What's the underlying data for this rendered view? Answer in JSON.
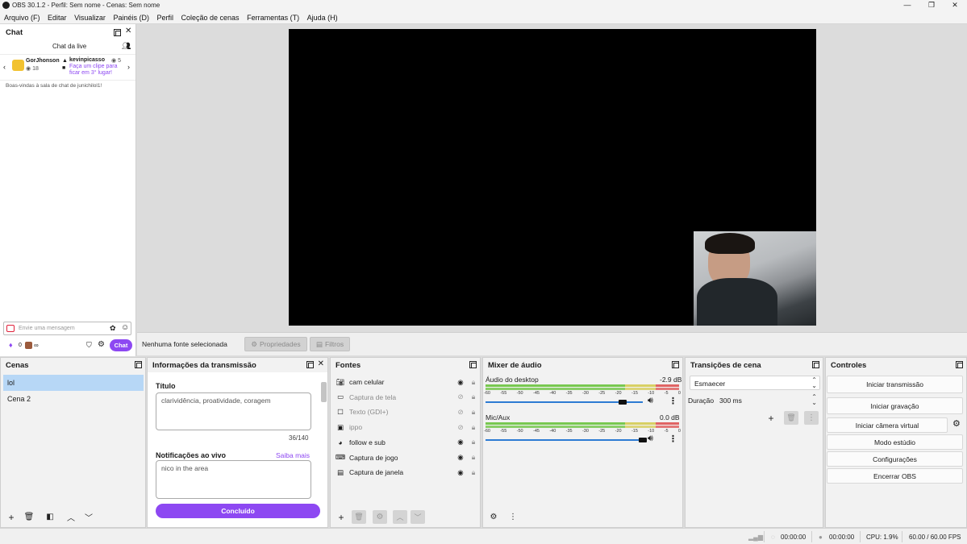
{
  "window": {
    "title": "OBS 30.1.2 - Perfil: Sem nome - Cenas: Sem nome",
    "minimize": "—",
    "maximize": "❐",
    "close": "✕"
  },
  "menu": [
    "Arquivo (F)",
    "Editar",
    "Visualizar",
    "Painéis (D)",
    "Perfil",
    "Coleção de cenas",
    "Ferramentas (T)",
    "Ajuda (H)"
  ],
  "chat": {
    "title": "Chat",
    "header": "Chat da live",
    "leaderboard": {
      "user1": "GorJhonson",
      "user1_views": "18",
      "user2": "kevinpicasso",
      "user2_views": "5",
      "promo": "Faça um clipe para ficar em 3° lugar!"
    },
    "welcome": "Boas-vindas à sala de chat de junichilol1!",
    "input_placeholder": "Envie uma mensagem",
    "points": "0",
    "infinity": "∞",
    "chat_button": "Chat"
  },
  "source_toolbar": {
    "status": "Nenhuma fonte selecionada",
    "properties": "Propriedades",
    "filters": "Filtros"
  },
  "scenes": {
    "title": "Cenas",
    "items": [
      {
        "name": "lol",
        "selected": true
      },
      {
        "name": "Cena 2",
        "selected": false
      }
    ]
  },
  "stream_info": {
    "title": "Informações da transmissão",
    "title_label": "Título",
    "title_value": "clarividência, proatividade, coragem",
    "counter": "36/140",
    "notif_label": "Notificações ao vivo",
    "learn_more": "Saiba mais",
    "notif_value": "nico in the area",
    "done": "Concluído"
  },
  "sources": {
    "title": "Fontes",
    "items": [
      {
        "name": "cam celular",
        "icon": "camera-icon",
        "visible": true
      },
      {
        "name": "Captura de tela",
        "icon": "monitor-icon",
        "visible": false
      },
      {
        "name": "Texto (GDI+)",
        "icon": "text-icon",
        "visible": false
      },
      {
        "name": "ippo",
        "icon": "image-icon",
        "visible": false
      },
      {
        "name": "follow e sub",
        "icon": "browser-icon",
        "visible": true
      },
      {
        "name": "Captura de jogo",
        "icon": "gamepad-icon",
        "visible": true
      },
      {
        "name": "Captura de janela",
        "icon": "window-icon",
        "visible": true
      }
    ]
  },
  "mixer": {
    "title": "Mixer de áudio",
    "ticks": [
      "-60",
      "-55",
      "-50",
      "-45",
      "-40",
      "-35",
      "-30",
      "-25",
      "-20",
      "-15",
      "-10",
      "-5",
      "0"
    ],
    "channels": [
      {
        "name": "Áudio do desktop",
        "db": "-2.9 dB",
        "volume": 0.87
      },
      {
        "name": "Mic/Aux",
        "db": "0.0 dB",
        "volume": 1.0
      }
    ]
  },
  "transitions": {
    "title": "Transições de cena",
    "selected": "Esmaecer",
    "duration_label": "Duração",
    "duration_value": "300 ms"
  },
  "controls": {
    "title": "Controles",
    "buttons": [
      "Iniciar transmissão",
      "Iniciar gravação",
      "Iniciar câmera virtual",
      "Modo estúdio",
      "Configurações",
      "Encerrar OBS"
    ]
  },
  "status": {
    "stream_time": "00:00:00",
    "rec_time": "00:00:00",
    "cpu": "CPU: 1.9%",
    "fps": "60.00 / 60.00 FPS"
  },
  "colors": {
    "accent_purple": "#8d48f2",
    "selection": "#b7d7f6",
    "volume_blue": "#2d7bd3"
  }
}
